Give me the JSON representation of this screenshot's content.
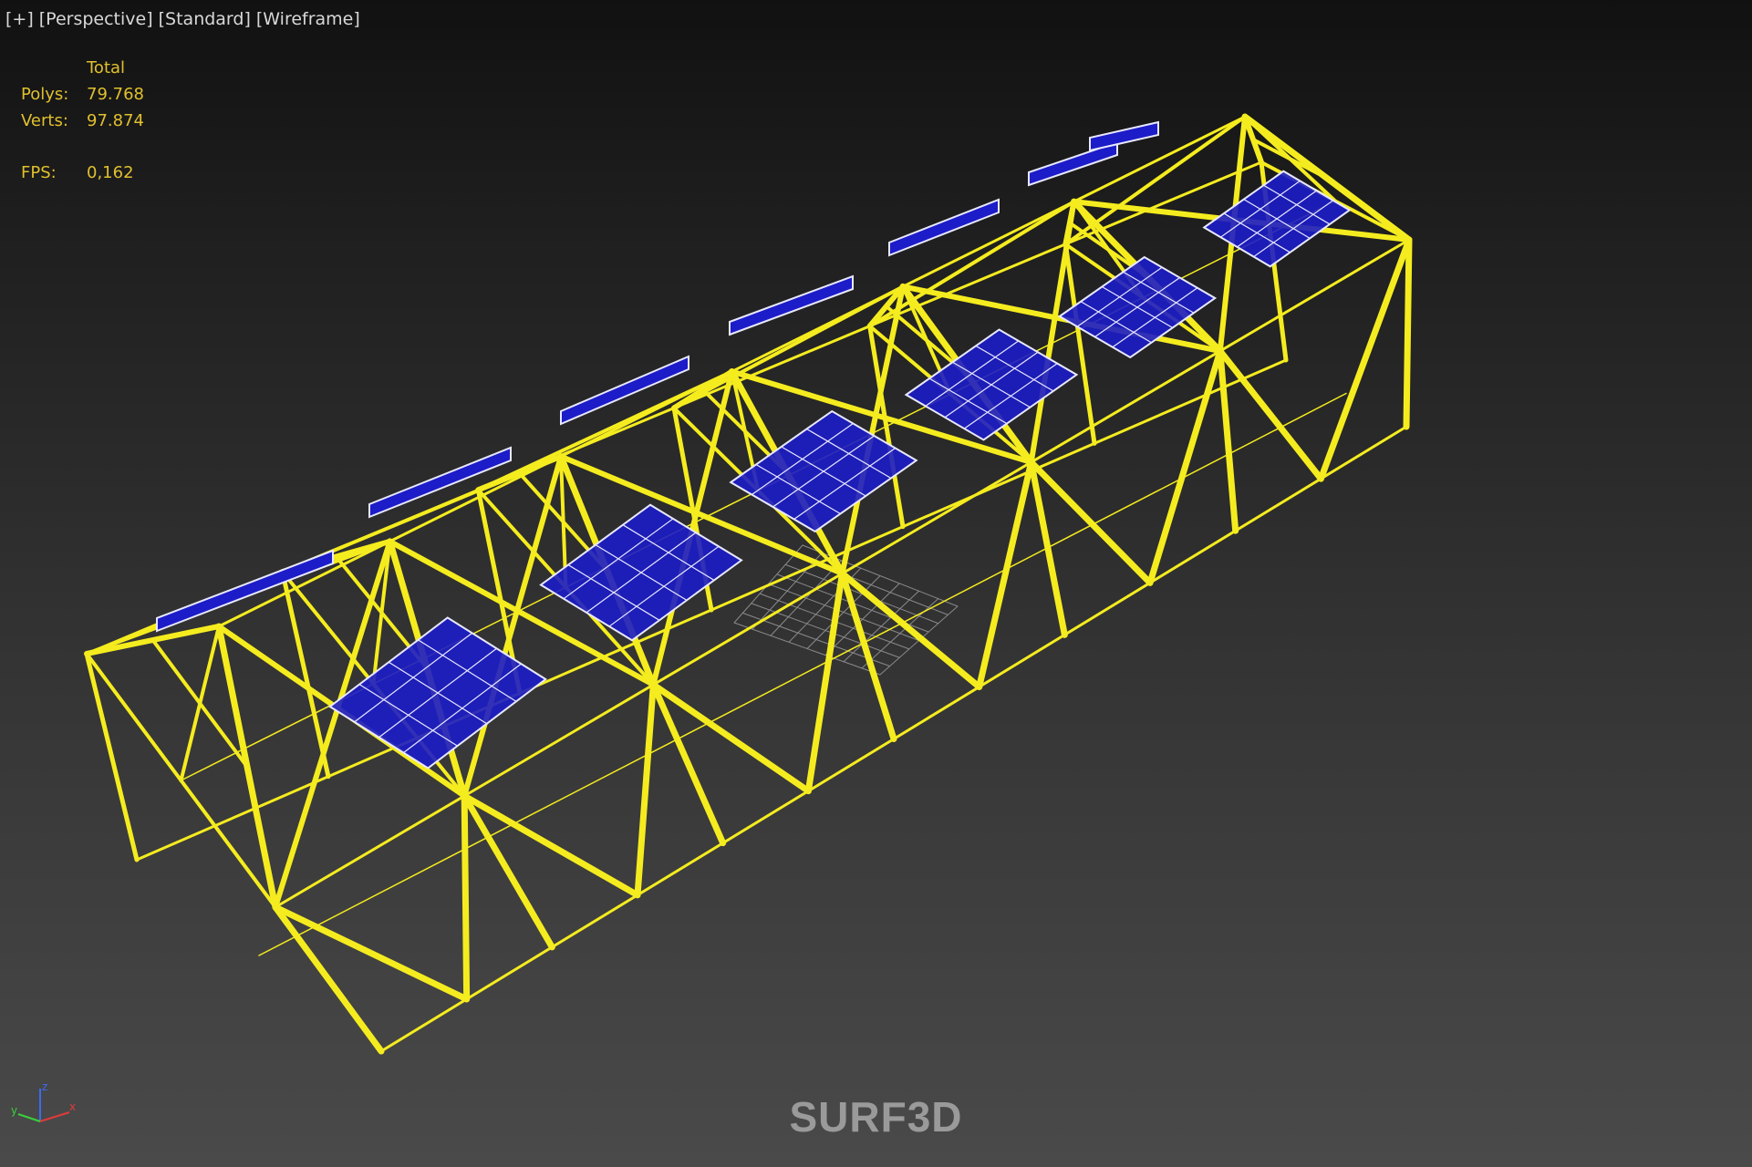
{
  "viewport": {
    "labels": [
      "[+]",
      "[Perspective]",
      "[Standard]",
      "[Wireframe]"
    ]
  },
  "stats": {
    "header": "Total",
    "polys_label": "Polys:",
    "polys_value": "79.768",
    "verts_label": "Verts:",
    "verts_value": "97.874",
    "fps_label": "FPS:",
    "fps_value": "0,162"
  },
  "colors": {
    "frame": "#f5ec1f",
    "panel_fill": "#1c1cc8",
    "panel_edge": "#e8e8ff",
    "ground_grid": "#8a8a8a",
    "stats_text": "#e0c02e",
    "label_text": "#d8d8d8"
  },
  "gizmo": {
    "x": "x",
    "y": "y",
    "z": "z"
  },
  "watermark": "SURF3D"
}
